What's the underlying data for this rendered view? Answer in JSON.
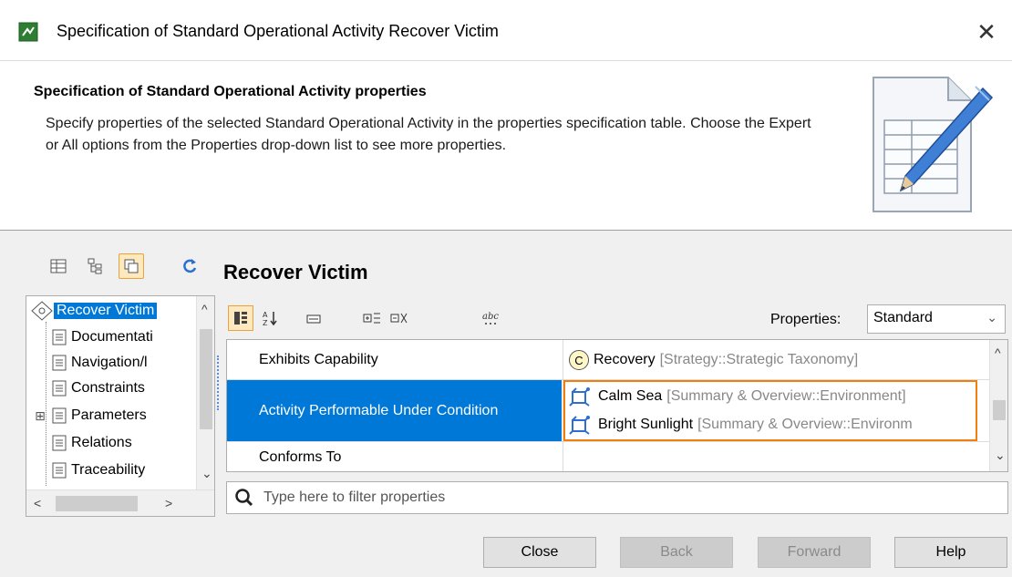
{
  "window": {
    "title": "Specification of Standard Operational Activity Recover Victim",
    "close_glyph": "✕"
  },
  "header": {
    "title": "Specification of Standard Operational Activity properties",
    "description": "Specify properties of the selected Standard Operational Activity in the properties specification table. Choose the Expert or All options from the Properties drop-down list to see more properties."
  },
  "element": {
    "title": "Recover Victim"
  },
  "tree": {
    "items": [
      {
        "label": "Recover Victim",
        "selected": true,
        "icon": "activity-icon"
      },
      {
        "label": "Documentati",
        "icon": "page-icon"
      },
      {
        "label": "Navigation/l",
        "icon": "page-icon"
      },
      {
        "label": "Constraints",
        "icon": "page-icon"
      },
      {
        "label": "Parameters",
        "icon": "page-icon",
        "expandable": true
      },
      {
        "label": "Relations",
        "icon": "page-icon"
      },
      {
        "label": "Traceability",
        "icon": "page-icon"
      }
    ],
    "expand_glyph": "⊞",
    "arrow_up": "^",
    "arrow_down": "⌄",
    "arrow_left": "<",
    "arrow_right": ">"
  },
  "properties": {
    "label": "Properties:",
    "selected": "Standard",
    "chevron": "⌄"
  },
  "grid": {
    "rows": [
      {
        "name": "Exhibits Capability",
        "values": [
          {
            "icon": "capability-icon",
            "icon_letter": "C",
            "name": "Recovery",
            "meta": "[Strategy::Strategic Taxonomy]"
          }
        ]
      },
      {
        "name": "Activity Performable Under Condition",
        "selected": true,
        "values": [
          {
            "icon": "condition-icon",
            "name": "Calm Sea",
            "meta": "[Summary & Overview::Environment]"
          },
          {
            "icon": "condition-icon",
            "name": "Bright Sunlight",
            "meta": "[Summary & Overview::Environm"
          }
        ]
      },
      {
        "name": "Conforms To",
        "values": []
      }
    ],
    "row_marker": "▶"
  },
  "filter": {
    "placeholder": "Type here to filter properties"
  },
  "buttons": {
    "close": "Close",
    "back": "Back",
    "forward": "Forward",
    "help": "Help"
  },
  "colors": {
    "selection": "#0078d7",
    "highlight_border": "#f07f0e",
    "accent_orange": "#e8a33a"
  }
}
